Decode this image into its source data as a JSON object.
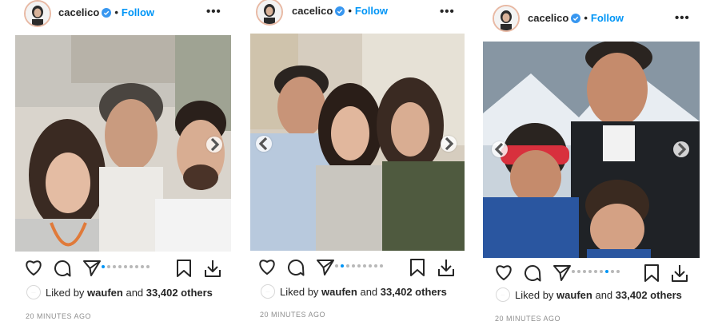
{
  "posts": [
    {
      "username": "cacelico",
      "follow_label": "Follow",
      "separator": "•",
      "more_label": "•••",
      "liked_prefix": "Liked by",
      "liked_user": "waufen",
      "liked_connector": "and",
      "liked_others": "33,402 others",
      "timestamp": "20 MINUTES AGO",
      "carousel": {
        "total": 9,
        "active_index": 0
      },
      "arrows": [
        "right"
      ]
    },
    {
      "username": "cacelico",
      "follow_label": "Follow",
      "separator": "•",
      "more_label": "•••",
      "liked_prefix": "Liked by",
      "liked_user": "waufen",
      "liked_connector": "and",
      "liked_others": "33,402 others",
      "timestamp": "20 MINUTES AGO",
      "carousel": {
        "total": 9,
        "active_index": 1
      },
      "arrows": [
        "left",
        "right"
      ]
    },
    {
      "username": "cacelico",
      "follow_label": "Follow",
      "separator": "•",
      "more_label": "•••",
      "liked_prefix": "Liked by",
      "liked_user": "waufen",
      "liked_connector": "and",
      "liked_others": "33,402 others",
      "timestamp": "20 MINUTES AGO",
      "carousel": {
        "total": 9,
        "active_index": 6
      },
      "arrows": [
        "left",
        "right"
      ]
    }
  ],
  "icons": [
    "heart-icon",
    "comment-icon",
    "share-icon",
    "bookmark-icon",
    "download-icon",
    "verified-badge-icon"
  ],
  "colors": {
    "follow": "#0095f6",
    "text": "#262626",
    "muted": "#8e8e8e",
    "dot_active": "#0095f6",
    "dot_inactive": "#b8b8b8"
  }
}
